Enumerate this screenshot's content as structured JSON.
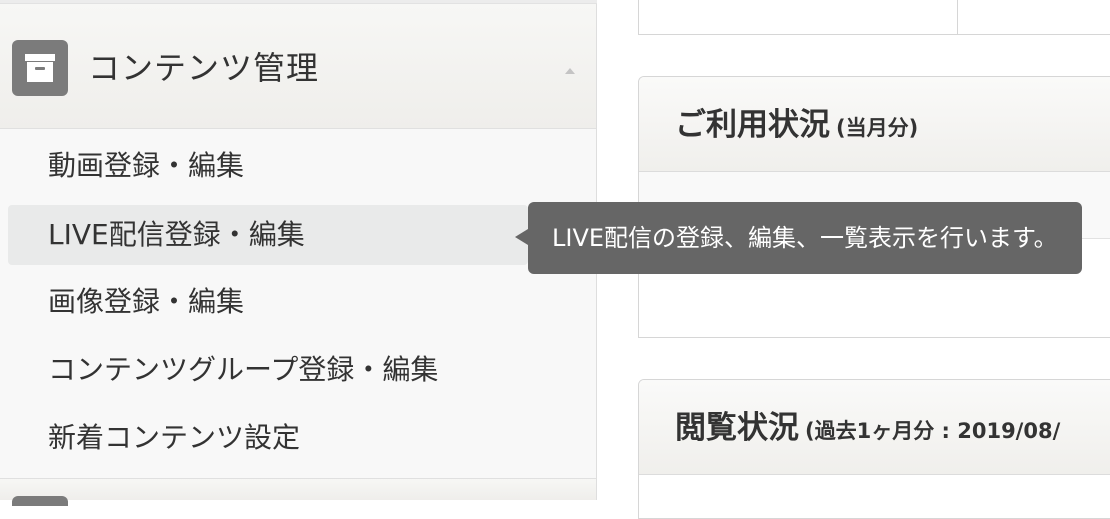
{
  "sidebar": {
    "section": {
      "title": "コンテンツ管理",
      "icon": "archive-box-icon",
      "expanded": true
    },
    "items": [
      {
        "label": "動画登録・編集"
      },
      {
        "label": "LIVE配信登録・編集",
        "active": true
      },
      {
        "label": "画像登録・編集"
      },
      {
        "label": "コンテンツグループ登録・編集"
      },
      {
        "label": "新着コンテンツ設定"
      }
    ]
  },
  "tooltip": {
    "text": "LIVE配信の登録、編集、一覧表示を行います。"
  },
  "main": {
    "usage_panel": {
      "title": "ご利用状況",
      "subtitle": "(当月分)"
    },
    "views_panel": {
      "title": "閲覧状況",
      "subtitle": "(過去1ヶ月分 : 2019/08/"
    }
  },
  "colors": {
    "sidebar_bg": "#f8f8f8",
    "active_item_bg": "#e9eaea",
    "icon_bg": "#7b7b7b",
    "tooltip_bg": "#666666",
    "text": "#333333"
  }
}
